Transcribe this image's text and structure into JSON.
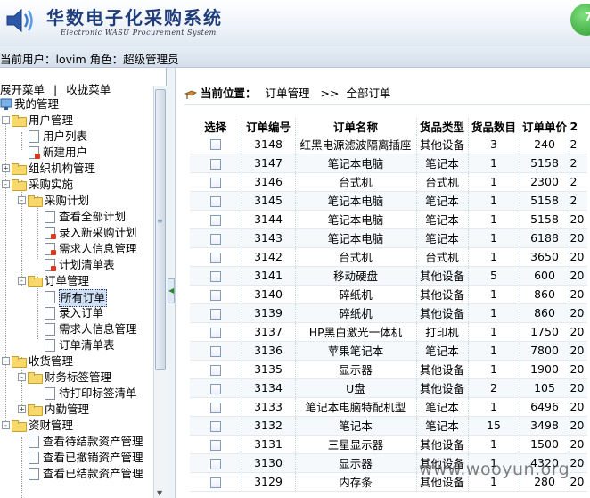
{
  "header": {
    "title": "华数电子化采购系统",
    "subtitle": "Electronic WASU Procurement System",
    "corner_badge": "7"
  },
  "userbar": {
    "text": "当前用户：lovim 角色：超级管理员"
  },
  "sidebar": {
    "expand_label": "展开菜单",
    "divider": "|",
    "collapse_label": "收拢菜单",
    "tree": [
      {
        "label": "我的管理",
        "icon": "monitor-icon"
      },
      {
        "label": "用户管理",
        "icon": "folder-icon",
        "toggle": "-"
      },
      {
        "label": "用户列表",
        "icon": "document-icon"
      },
      {
        "label": "新建用户",
        "icon": "document-new-icon"
      },
      {
        "label": "组织机构管理",
        "icon": "folder-icon",
        "toggle": "+"
      },
      {
        "label": "采购实施",
        "icon": "folder-icon",
        "toggle": "-"
      },
      {
        "label": "采购计划",
        "icon": "folder-icon",
        "toggle": "-"
      },
      {
        "label": "查看全部计划",
        "icon": "document-icon"
      },
      {
        "label": "录入新采购计划",
        "icon": "document-new-icon"
      },
      {
        "label": "需求人信息管理",
        "icon": "document-new-icon"
      },
      {
        "label": "计划清单表",
        "icon": "document-new-icon"
      },
      {
        "label": "订单管理",
        "icon": "folder-icon",
        "toggle": "-"
      },
      {
        "label": "所有订单",
        "icon": "document-icon"
      },
      {
        "label": "录入订单",
        "icon": "document-icon"
      },
      {
        "label": "需求人信息管理",
        "icon": "document-icon"
      },
      {
        "label": "订单清单表",
        "icon": "document-icon"
      },
      {
        "label": "收货管理",
        "icon": "folder-icon",
        "toggle": "-"
      },
      {
        "label": "财务标签管理",
        "icon": "folder-icon",
        "toggle": "-"
      },
      {
        "label": "待打印标签清单",
        "icon": "document-icon"
      },
      {
        "label": "内勤管理",
        "icon": "folder-icon",
        "toggle": "+"
      },
      {
        "label": "资财管理",
        "icon": "folder-icon",
        "toggle": "-"
      },
      {
        "label": "查看待结款资产管理",
        "icon": "document-icon"
      },
      {
        "label": "查看已撤销资产管理",
        "icon": "document-icon"
      },
      {
        "label": "查看已结款资产管理",
        "icon": "document-icon"
      }
    ]
  },
  "breadcrumb": {
    "prefix": "当前位置：",
    "section": "订单管理",
    "separator": ">>",
    "page": "全部订单"
  },
  "table": {
    "columns": [
      "选择",
      "订单编号",
      "订单名称",
      "货品类型",
      "货品数目",
      "订单单价",
      "2"
    ],
    "rows": [
      {
        "id": "3148",
        "name": "红黑电源滤波隔离插座",
        "type": "其他设备",
        "qty": "3",
        "price": "240",
        "extra": "2"
      },
      {
        "id": "3147",
        "name": "笔记本电脑",
        "type": "笔记本",
        "qty": "1",
        "price": "5158",
        "extra": "2"
      },
      {
        "id": "3146",
        "name": "台式机",
        "type": "台式机",
        "qty": "1",
        "price": "2300",
        "extra": "2"
      },
      {
        "id": "3145",
        "name": "笔记本电脑",
        "type": "笔记本",
        "qty": "1",
        "price": "5158",
        "extra": "2"
      },
      {
        "id": "3144",
        "name": "笔记本电脑",
        "type": "笔记本",
        "qty": "1",
        "price": "5158",
        "extra": "20"
      },
      {
        "id": "3143",
        "name": "笔记本电脑",
        "type": "笔记本",
        "qty": "1",
        "price": "6188",
        "extra": "20"
      },
      {
        "id": "3142",
        "name": "台式机",
        "type": "台式机",
        "qty": "1",
        "price": "3650",
        "extra": "20"
      },
      {
        "id": "3141",
        "name": "移动硬盘",
        "type": "其他设备",
        "qty": "5",
        "price": "600",
        "extra": "20"
      },
      {
        "id": "3140",
        "name": "碎纸机",
        "type": "其他设备",
        "qty": "1",
        "price": "860",
        "extra": "20"
      },
      {
        "id": "3139",
        "name": "碎纸机",
        "type": "其他设备",
        "qty": "1",
        "price": "860",
        "extra": "20"
      },
      {
        "id": "3137",
        "name": "HP黑白激光一体机",
        "type": "打印机",
        "qty": "1",
        "price": "1750",
        "extra": "20"
      },
      {
        "id": "3136",
        "name": "苹果笔记本",
        "type": "笔记本",
        "qty": "1",
        "price": "7800",
        "extra": "20"
      },
      {
        "id": "3135",
        "name": "显示器",
        "type": "其他设备",
        "qty": "1",
        "price": "1900",
        "extra": "20"
      },
      {
        "id": "3134",
        "name": "U盘",
        "type": "其他设备",
        "qty": "2",
        "price": "105",
        "extra": "20"
      },
      {
        "id": "3133",
        "name": "笔记本电脑特配机型",
        "type": "笔记本",
        "qty": "1",
        "price": "6496",
        "extra": "20"
      },
      {
        "id": "3132",
        "name": "笔记本",
        "type": "笔记本",
        "qty": "15",
        "price": "3498",
        "extra": "20"
      },
      {
        "id": "3131",
        "name": "三星显示器",
        "type": "其他设备",
        "qty": "1",
        "price": "1500",
        "extra": "20"
      },
      {
        "id": "3130",
        "name": "显示器",
        "type": "其他设备",
        "qty": "1",
        "price": "4320",
        "extra": "20"
      },
      {
        "id": "3129",
        "name": "内存条",
        "type": "其他设备",
        "qty": "1",
        "price": "280",
        "extra": "20"
      }
    ]
  },
  "watermark": "www.wooyun.org"
}
